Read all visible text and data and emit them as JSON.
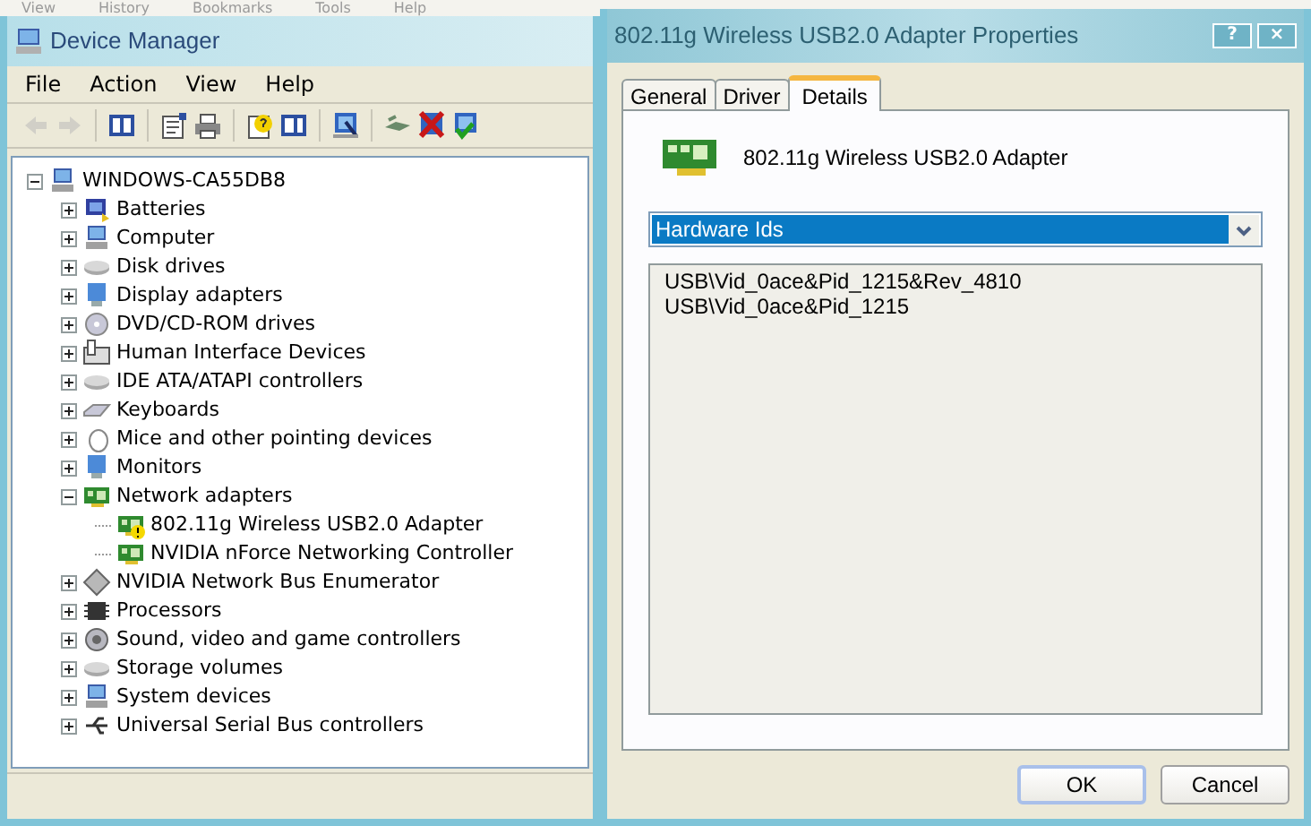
{
  "background_menu": [
    "View",
    "History",
    "Bookmarks",
    "Tools",
    "Help"
  ],
  "device_manager": {
    "title": "Device Manager",
    "menu": [
      "File",
      "Action",
      "View",
      "Help"
    ],
    "toolbar": [
      {
        "kind": "back",
        "disabled": true
      },
      {
        "kind": "forward",
        "disabled": true
      },
      {
        "kind": "sep"
      },
      {
        "kind": "console",
        "disabled": false
      },
      {
        "kind": "sep"
      },
      {
        "kind": "properties",
        "disabled": false
      },
      {
        "kind": "print",
        "disabled": false
      },
      {
        "kind": "sep"
      },
      {
        "kind": "help",
        "disabled": false
      },
      {
        "kind": "pane",
        "disabled": false
      },
      {
        "kind": "sep"
      },
      {
        "kind": "scan",
        "disabled": false
      },
      {
        "kind": "sep"
      },
      {
        "kind": "plug",
        "disabled": false
      },
      {
        "kind": "uninstall",
        "disabled": false
      },
      {
        "kind": "enable",
        "disabled": false
      }
    ],
    "tree": {
      "label": "WINDOWS-CA55DB8",
      "kind": "computer",
      "expanded": true,
      "children": [
        {
          "label": "Batteries",
          "kind": "battery",
          "expanded": false
        },
        {
          "label": "Computer",
          "kind": "computer",
          "expanded": false
        },
        {
          "label": "Disk drives",
          "kind": "disk",
          "expanded": false
        },
        {
          "label": "Display adapters",
          "kind": "monitor",
          "expanded": false
        },
        {
          "label": "DVD/CD-ROM drives",
          "kind": "disc",
          "expanded": false
        },
        {
          "label": "Human Interface Devices",
          "kind": "hid",
          "expanded": false
        },
        {
          "label": "IDE ATA/ATAPI controllers",
          "kind": "disk",
          "expanded": false
        },
        {
          "label": "Keyboards",
          "kind": "keyboard",
          "expanded": false
        },
        {
          "label": "Mice and other pointing devices",
          "kind": "mouse",
          "expanded": false
        },
        {
          "label": "Monitors",
          "kind": "monitor",
          "expanded": false
        },
        {
          "label": "Network adapters",
          "kind": "card",
          "expanded": true,
          "children": [
            {
              "label": "802.11g Wireless USB2.0 Adapter",
              "kind": "card",
              "warning": true
            },
            {
              "label": "NVIDIA nForce Networking Controller",
              "kind": "card",
              "warning": false
            }
          ]
        },
        {
          "label": "NVIDIA Network Bus Enumerator",
          "kind": "diamond",
          "expanded": false
        },
        {
          "label": "Processors",
          "kind": "chip",
          "expanded": false
        },
        {
          "label": "Sound, video and game controllers",
          "kind": "speaker",
          "expanded": false
        },
        {
          "label": "Storage volumes",
          "kind": "disk",
          "expanded": false
        },
        {
          "label": "System devices",
          "kind": "computer",
          "expanded": false
        },
        {
          "label": "Universal Serial Bus controllers",
          "kind": "usb",
          "expanded": false
        }
      ]
    }
  },
  "properties": {
    "title": "802.11g Wireless USB2.0 Adapter Properties",
    "title_buttons": [
      "?",
      "×"
    ],
    "tabs": [
      {
        "label": "General",
        "selected": false
      },
      {
        "label": "Driver",
        "selected": false
      },
      {
        "label": "Details",
        "selected": true
      }
    ],
    "device_name": "802.11g Wireless USB2.0 Adapter",
    "property_dropdown": {
      "value": "Hardware Ids"
    },
    "values": [
      "USB\\Vid_0ace&Pid_1215&Rev_4810",
      "USB\\Vid_0ace&Pid_1215"
    ],
    "buttons": [
      {
        "label": "OK",
        "default": true
      },
      {
        "label": "Cancel",
        "default": false
      }
    ]
  }
}
